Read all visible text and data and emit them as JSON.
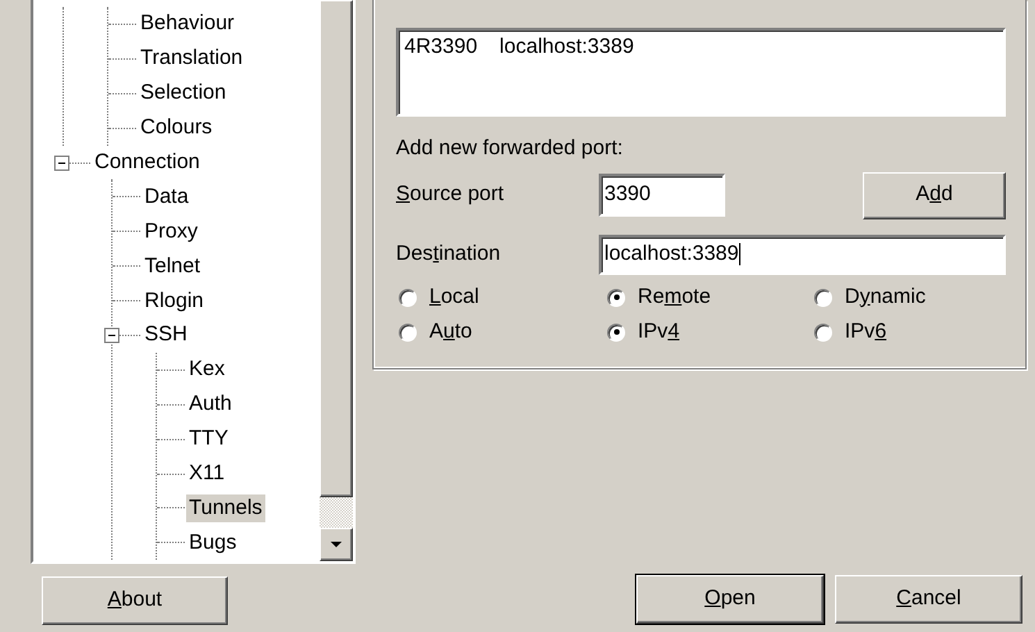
{
  "tree": {
    "items": [
      {
        "children": [
          {
            "label": "Behaviour",
            "selected": false
          },
          {
            "label": "Translation",
            "selected": false
          },
          {
            "label": "Selection",
            "selected": false
          },
          {
            "label": "Colours",
            "selected": false
          }
        ]
      },
      {
        "label": "Connection",
        "expanded": true,
        "selected": false,
        "children": [
          {
            "label": "Data",
            "selected": false
          },
          {
            "label": "Proxy",
            "selected": false
          },
          {
            "label": "Telnet",
            "selected": false
          },
          {
            "label": "Rlogin",
            "selected": false
          },
          {
            "label": "SSH",
            "expanded": true,
            "selected": false,
            "children": [
              {
                "label": "Kex",
                "selected": false
              },
              {
                "label": "Auth",
                "selected": false
              },
              {
                "label": "TTY",
                "selected": false
              },
              {
                "label": "X11",
                "selected": false
              },
              {
                "label": "Tunnels",
                "selected": true
              },
              {
                "label": "Bugs",
                "selected": false
              }
            ]
          }
        ]
      }
    ]
  },
  "about_button": {
    "key": "A",
    "post": "bout"
  },
  "forwarded_ports": [
    {
      "source": "4R3390",
      "destination": "localhost:3389"
    }
  ],
  "add_section": {
    "heading": "Add new forwarded port:",
    "source_port": {
      "label": {
        "key": "S",
        "post": "ource port"
      },
      "value": "3390"
    },
    "add_button": {
      "pre": "A",
      "key": "d",
      "post": "d"
    },
    "destination": {
      "label": {
        "pre": "Des",
        "key": "t",
        "post": "ination"
      },
      "value": "localhost:3389"
    },
    "direction": [
      {
        "key": "L",
        "post": "ocal",
        "selected": false
      },
      {
        "pre": "Re",
        "key": "m",
        "post": "ote",
        "selected": true
      },
      {
        "pre": "D",
        "key": "y",
        "post": "namic",
        "selected": false
      }
    ],
    "ip_version": [
      {
        "pre": "A",
        "key": "u",
        "post": "to",
        "selected": false
      },
      {
        "pre": "IPv",
        "key": "4",
        "selected": true
      },
      {
        "pre": "IPv",
        "key": "6",
        "selected": false
      }
    ]
  },
  "buttons": [
    {
      "key": "O",
      "post": "pen",
      "default": true
    },
    {
      "key": "C",
      "post": "ancel",
      "default": false
    }
  ]
}
